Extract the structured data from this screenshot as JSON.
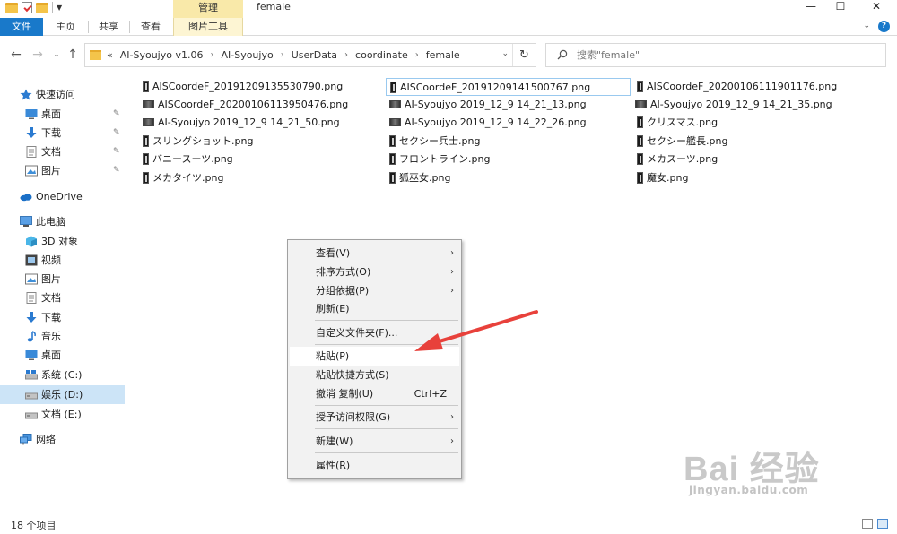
{
  "window": {
    "manage_tab": "管理",
    "title": "female",
    "minimize": "—",
    "maximize": "☐",
    "close": "✕"
  },
  "ribbon": {
    "tabs": [
      "文件",
      "主页",
      "共享",
      "查看",
      "图片工具"
    ]
  },
  "address": {
    "prefix": "«",
    "crumbs": [
      "AI-Syoujyo v1.06",
      "AI-Syoujyo",
      "UserData",
      "coordinate",
      "female"
    ]
  },
  "search": {
    "placeholder": "搜索\"female\""
  },
  "sidebar": {
    "items": [
      {
        "label": "快速访问",
        "icon": "star-icon"
      },
      {
        "label": "桌面",
        "icon": "desktop-icon"
      },
      {
        "label": "下载",
        "icon": "download-icon"
      },
      {
        "label": "文档",
        "icon": "document-icon"
      },
      {
        "label": "图片",
        "icon": "picture-icon"
      },
      {
        "label": "OneDrive",
        "icon": "cloud-icon"
      },
      {
        "label": "此电脑",
        "icon": "computer-icon"
      },
      {
        "label": "3D 对象",
        "icon": "cube-icon"
      },
      {
        "label": "视频",
        "icon": "video-icon"
      },
      {
        "label": "图片",
        "icon": "picture-icon"
      },
      {
        "label": "文档",
        "icon": "document-icon"
      },
      {
        "label": "下载",
        "icon": "download-icon"
      },
      {
        "label": "音乐",
        "icon": "music-icon"
      },
      {
        "label": "桌面",
        "icon": "desktop-icon"
      },
      {
        "label": "系统 (C:)",
        "icon": "drive-icon"
      },
      {
        "label": "娱乐 (D:)",
        "icon": "drive-icon"
      },
      {
        "label": "文档 (E:)",
        "icon": "drive-icon"
      },
      {
        "label": "网络",
        "icon": "network-icon"
      }
    ],
    "pin_glyph": "📌"
  },
  "files": [
    "AISCoordeF_20191209135530790.png",
    "AISCoordeF_20191209141500767.png",
    "AISCoordeF_20200106111901176.png",
    "AISCoordeF_20200106113950476.png",
    "AI-Syoujyo 2019_12_9 14_21_13.png",
    "AI-Syoujyo 2019_12_9 14_21_35.png",
    "AI-Syoujyo 2019_12_9 14_21_50.png",
    "AI-Syoujyo 2019_12_9 14_22_26.png",
    "クリスマス.png",
    "スリングショット.png",
    "セクシー兵士.png",
    "セクシー艦長.png",
    "バニースーツ.png",
    "フロントライン.png",
    "メカスーツ.png",
    "メカタイツ.png",
    "狐巫女.png",
    "魔女.png"
  ],
  "context_menu": {
    "items": [
      {
        "label": "查看(V)",
        "submenu": true
      },
      {
        "label": "排序方式(O)",
        "submenu": true
      },
      {
        "label": "分组依据(P)",
        "submenu": true
      },
      {
        "label": "刷新(E)"
      },
      {
        "label": "自定义文件夹(F)..."
      },
      {
        "label": "粘贴(P)"
      },
      {
        "label": "粘贴快捷方式(S)"
      },
      {
        "label": "撤消 复制(U)",
        "shortcut": "Ctrl+Z"
      },
      {
        "label": "授予访问权限(G)",
        "submenu": true
      },
      {
        "label": "新建(W)",
        "submenu": true
      },
      {
        "label": "属性(R)"
      }
    ]
  },
  "status": {
    "count": "18 个项目"
  },
  "watermark": {
    "brand": "Bai 经验",
    "url": "jingyan.baidu.com"
  },
  "colors": {
    "accent": "#1979ca",
    "selection": "#cce4f7",
    "arrow": "#e8413b"
  }
}
